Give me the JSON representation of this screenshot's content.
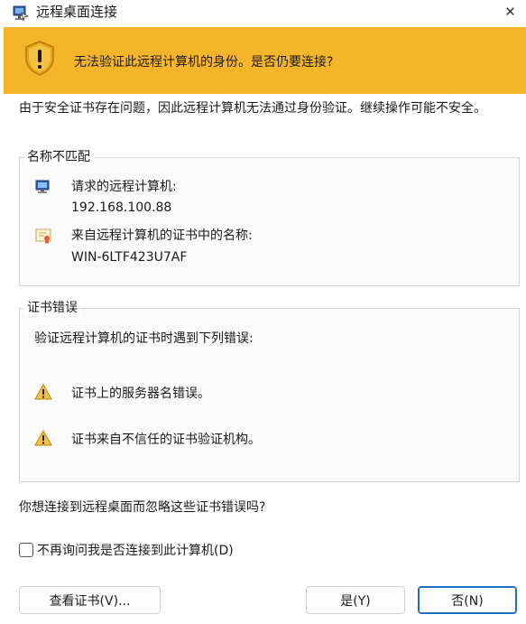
{
  "window": {
    "title": "远程桌面连接",
    "close_glyph": "✕"
  },
  "banner": {
    "message": "无法验证此远程计算机的身份。是否仍要连接?",
    "color": "#f5b52a",
    "icon": "shield-warning-icon"
  },
  "description": "由于安全证书存在问题，因此远程计算机无法通过身份验证。继续操作可能不安全。",
  "name_mismatch": {
    "label": "名称不匹配",
    "requested_label": "请求的远程计算机:",
    "requested_value": "192.168.100.88",
    "cert_label": "来自远程计算机的证书中的名称:",
    "cert_value": "WIN-6LTF423U7AF"
  },
  "cert_errors": {
    "label": "证书错误",
    "intro": "验证远程计算机的证书时遇到下列错误:",
    "errors": [
      "证书上的服务器名错误。",
      "证书来自不信任的证书验证机构。"
    ]
  },
  "question": "你想连接到远程桌面而忽略这些证书错误吗?",
  "checkbox": {
    "label": "不再询问我是否连接到此计算机(D)",
    "checked": false
  },
  "buttons": {
    "view_cert": "查看证书(V)...",
    "yes": "是(Y)",
    "no": "否(N)"
  }
}
